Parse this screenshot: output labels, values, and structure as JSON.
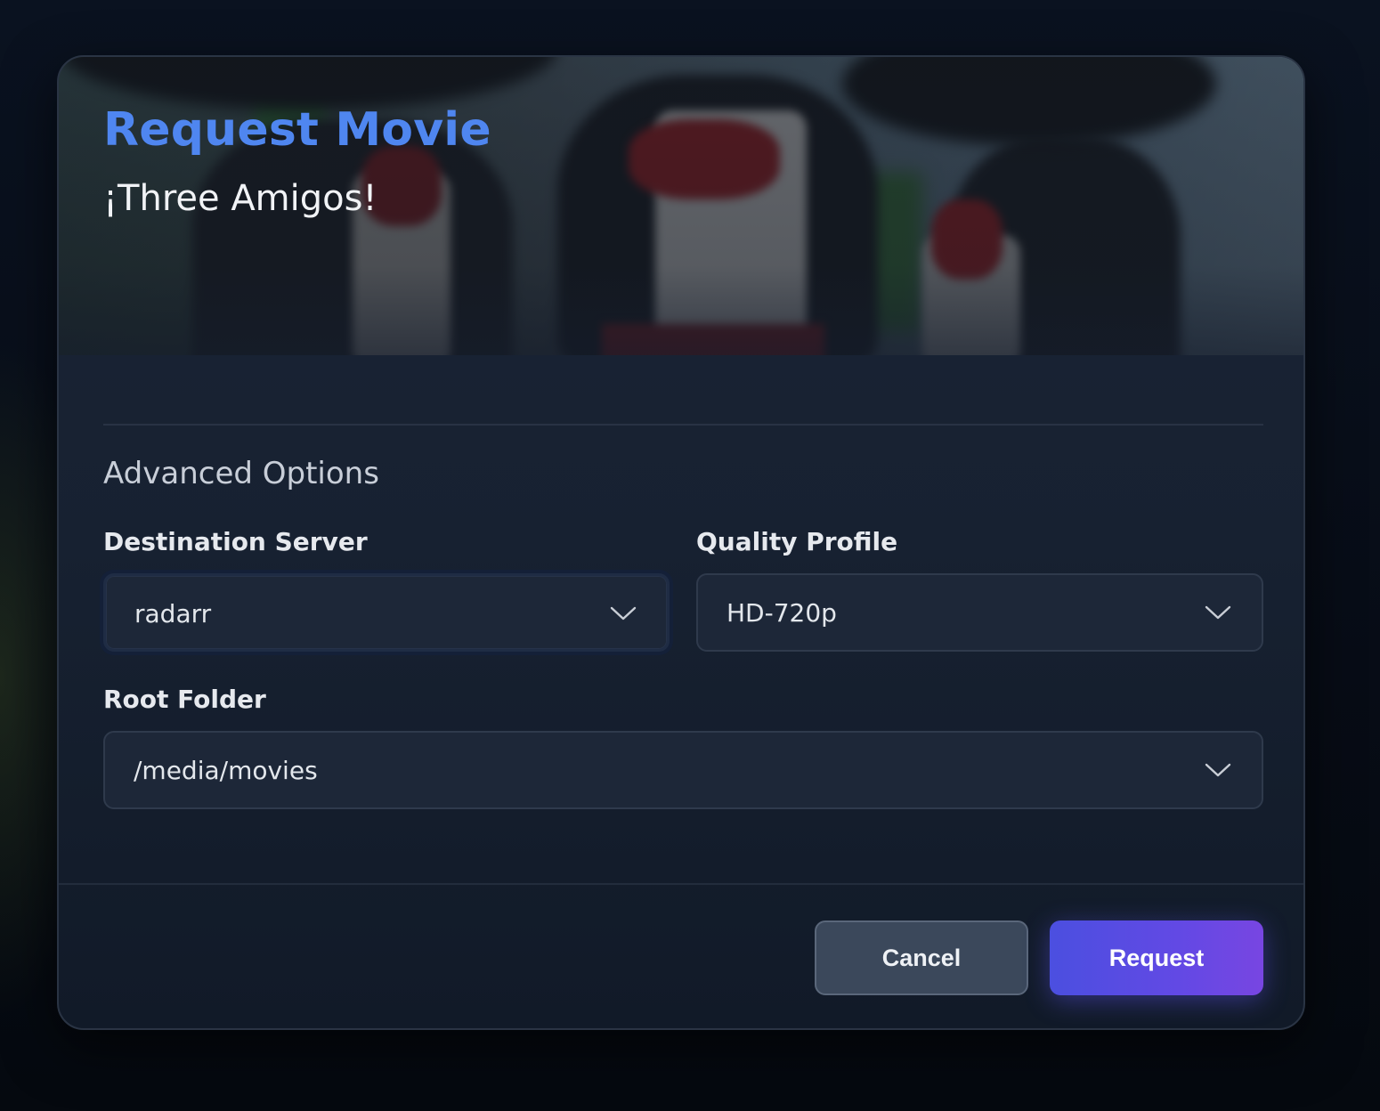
{
  "modal": {
    "title": "Request Movie",
    "movie_title": "¡Three Amigos!"
  },
  "advanced": {
    "section_title": "Advanced Options",
    "destination_server": {
      "label": "Destination Server",
      "value": "radarr"
    },
    "quality_profile": {
      "label": "Quality Profile",
      "value": "HD-720p"
    },
    "root_folder": {
      "label": "Root Folder",
      "value": "/media/movies"
    }
  },
  "actions": {
    "cancel_label": "Cancel",
    "request_label": "Request"
  },
  "icons": {
    "dropdown": "chevron-down-icon"
  },
  "colors": {
    "title_accent": "#4f86f0",
    "request_button_start": "#4b4fe0",
    "request_button_end": "#7846e2",
    "cancel_button": "#3b485b"
  }
}
